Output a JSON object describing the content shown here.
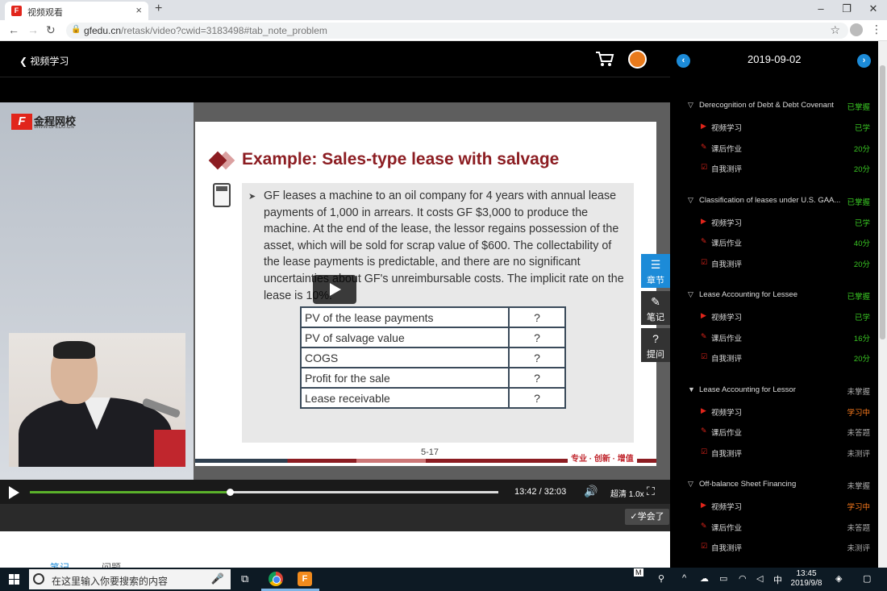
{
  "browser": {
    "tab_title": "视频观看",
    "tab_favicon": "F",
    "url_host": "gfedu.cn",
    "url_path": "/retask/video?cwid=3183498#tab_note_problem"
  },
  "page": {
    "back_label": "视频学习"
  },
  "logo": {
    "mark": "F",
    "name": "金程网校",
    "site": "WWW.GFEDU.CN"
  },
  "slide": {
    "title": "Example: Sales-type lease with salvage",
    "bullet": "➤",
    "text": "GF leases a machine to an oil company for 4 years with annual lease payments of 1,000 in arrears. It costs GF $3,000 to produce the machine. At the end of the lease, the lessor regains possession of the asset, which will be sold for scrap value of $600. The collectability of the lease payments is predictable, and there are no significant uncertainties about GF's unreimbursable costs. The implicit rate on the lease is 10%.",
    "table": [
      {
        "label": "PV of the lease payments",
        "value": "?"
      },
      {
        "label": "PV of salvage value",
        "value": "?"
      },
      {
        "label": "COGS",
        "value": "?"
      },
      {
        "label": "Profit for the sale",
        "value": "?"
      },
      {
        "label": "Lease receivable",
        "value": "?"
      }
    ],
    "page_number": "5-17",
    "slogan": "专业 · 创新 · 增值"
  },
  "tools": {
    "chapter": "章节",
    "note": "笔记",
    "ask": "提问"
  },
  "player": {
    "time_current": "13:42",
    "time_total": "32:03",
    "progress": 0.427,
    "quality": "超清 1.0x",
    "learned_button": "✓学会了"
  },
  "bottom_tabs": {
    "notes": "笔记",
    "questions": "问题"
  },
  "panel": {
    "date": "2019-09-02",
    "sections": [
      {
        "title": "Derecognition of Debt & Debt Covenant",
        "status": "已掌握",
        "status_color": "green",
        "items": [
          {
            "icon": "video-icon",
            "label": "视频学习",
            "status": "已学",
            "status_color": "green"
          },
          {
            "icon": "homework-icon",
            "label": "课后作业",
            "status": "20分",
            "status_color": "green"
          },
          {
            "icon": "test-icon",
            "label": "自我测评",
            "status": "20分",
            "status_color": "green"
          }
        ]
      },
      {
        "title": "Classification of leases under U.S. GAA...",
        "status": "已掌握",
        "status_color": "green",
        "items": [
          {
            "icon": "video-icon",
            "label": "视频学习",
            "status": "已学",
            "status_color": "green"
          },
          {
            "icon": "homework-icon",
            "label": "课后作业",
            "status": "40分",
            "status_color": "green"
          },
          {
            "icon": "test-icon",
            "label": "自我测评",
            "status": "20分",
            "status_color": "green"
          }
        ]
      },
      {
        "title": "Lease Accounting for Lessee",
        "status": "已掌握",
        "status_color": "green",
        "items": [
          {
            "icon": "video-icon",
            "label": "视频学习",
            "status": "已学",
            "status_color": "green"
          },
          {
            "icon": "homework-icon",
            "label": "课后作业",
            "status": "16分",
            "status_color": "green"
          },
          {
            "icon": "test-icon",
            "label": "自我测评",
            "status": "20分",
            "status_color": "green"
          }
        ]
      },
      {
        "title": "Lease Accounting for Lessor",
        "status": "未掌握",
        "status_color": "grey",
        "items": [
          {
            "icon": "video-icon",
            "label": "视频学习",
            "status": "学习中",
            "status_color": "orange"
          },
          {
            "icon": "homework-icon",
            "label": "课后作业",
            "status": "未答题",
            "status_color": "grey"
          },
          {
            "icon": "test-icon",
            "label": "自我测评",
            "status": "未测评",
            "status_color": "grey"
          }
        ]
      },
      {
        "title": "Off-balance Sheet Financing",
        "status": "未掌握",
        "status_color": "grey",
        "items": [
          {
            "icon": "video-icon",
            "label": "视频学习",
            "status": "学习中",
            "status_color": "orange"
          },
          {
            "icon": "homework-icon",
            "label": "课后作业",
            "status": "未答题",
            "status_color": "grey"
          },
          {
            "icon": "test-icon",
            "label": "自我测评",
            "status": "未测评",
            "status_color": "grey"
          }
        ]
      }
    ]
  },
  "taskbar": {
    "search_placeholder": "在这里输入你要搜索的内容",
    "ime": "中",
    "time": "13:45",
    "date": "2019/9/8",
    "tray_letter": "M"
  },
  "colors": {
    "accent_blue": "#1c8bd8",
    "green": "#39c523",
    "orange": "#ff7d1d",
    "brand_red": "#e1251b"
  }
}
